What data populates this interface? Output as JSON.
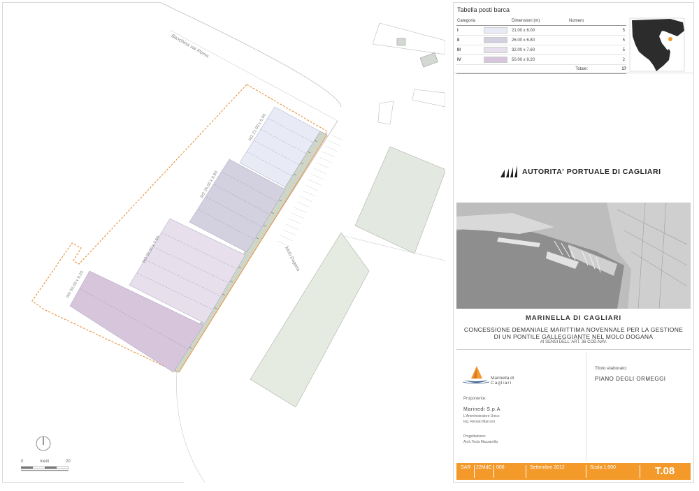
{
  "plan": {
    "street_label": "Banchina via Roma",
    "mole_label": "Molo Dogana",
    "pier_labels": [
      "W4 50.00 x 9.20",
      "W3 32.00 x 7.60",
      "W2 26.00 x 6.80",
      "W1 21.00 x 6.00"
    ],
    "scale_label": "metri",
    "scale_start": "0",
    "scale_end": "20",
    "colors": {
      "cat_I": "#e8ebf6",
      "cat_II": "#d3d1e0",
      "cat_III": "#e7dfec",
      "cat_IV": "#d7c5dc",
      "concession_line": "#e8913a",
      "accent": "#f39a2b"
    }
  },
  "table": {
    "title": "Tabella posti barca",
    "headers": {
      "category": "Categoria",
      "dimensions": "Dimensioni (m)",
      "number": "Numero"
    },
    "rows": [
      {
        "category": "I",
        "dimensions": "21.00 x 6.00",
        "number": "5",
        "color": "#e8ebf6"
      },
      {
        "category": "II",
        "dimensions": "26.00 x 6.80",
        "number": "5",
        "color": "#d3d1e0"
      },
      {
        "category": "III",
        "dimensions": "32.00 x 7.60",
        "number": "5",
        "color": "#e7dfec"
      },
      {
        "category": "IV",
        "dimensions": "50.00 x 9.20",
        "number": "2",
        "color": "#d7c5dc"
      }
    ],
    "total_label": "Totale:",
    "total_value": "17"
  },
  "authority": {
    "name": "AUTORITA' PORTUALE DI CAGLIARI"
  },
  "title": {
    "main": "MARINELLA DI CAGLIARI",
    "line1": "CONCESSIONE DEMANIALE MARITTIMA NOVENNALE PER LA GESTIONE",
    "line2": "DI UN PONTILE GALLEGGIANTE NEL MOLO DOGANA",
    "line3": "AI SENSI DELL' ART. 36 COD.NAV."
  },
  "logo": {
    "line1": "Marinella di",
    "line2": "Cagliari"
  },
  "proponent": {
    "label": "Proponente:",
    "company": "Marinedi S.p.A",
    "role": "L'Amministratore Unico",
    "person": "Ing. Renato Marconi"
  },
  "design": {
    "label": "Progettazione:",
    "person": "Arch.Tecla Mazzarella"
  },
  "drawing": {
    "label": "Titolo elaborato:",
    "value": "PIANO DEGLI ORMEGGI"
  },
  "footer": {
    "code1": "SAR",
    "code2": "22MdC",
    "code3": "008",
    "date": "Settembre 2012",
    "scale": "Scala 1:500",
    "sheet": "T.08"
  }
}
